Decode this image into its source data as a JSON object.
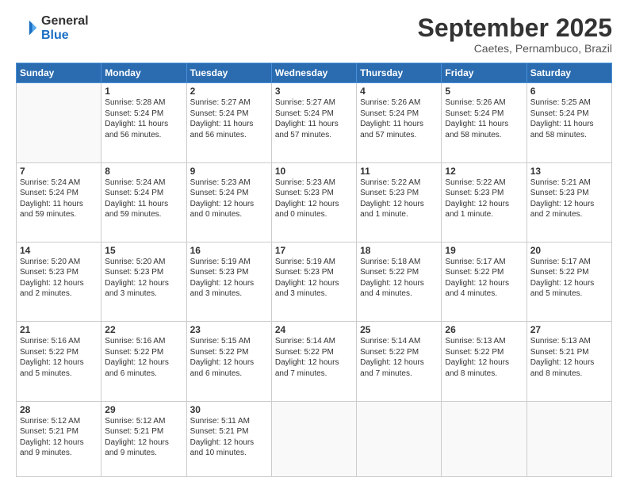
{
  "header": {
    "logo_line1": "General",
    "logo_line2": "Blue",
    "month": "September 2025",
    "location": "Caetes, Pernambuco, Brazil"
  },
  "weekdays": [
    "Sunday",
    "Monday",
    "Tuesday",
    "Wednesday",
    "Thursday",
    "Friday",
    "Saturday"
  ],
  "weeks": [
    [
      {
        "day": "",
        "info": ""
      },
      {
        "day": "1",
        "info": "Sunrise: 5:28 AM\nSunset: 5:24 PM\nDaylight: 11 hours\nand 56 minutes."
      },
      {
        "day": "2",
        "info": "Sunrise: 5:27 AM\nSunset: 5:24 PM\nDaylight: 11 hours\nand 56 minutes."
      },
      {
        "day": "3",
        "info": "Sunrise: 5:27 AM\nSunset: 5:24 PM\nDaylight: 11 hours\nand 57 minutes."
      },
      {
        "day": "4",
        "info": "Sunrise: 5:26 AM\nSunset: 5:24 PM\nDaylight: 11 hours\nand 57 minutes."
      },
      {
        "day": "5",
        "info": "Sunrise: 5:26 AM\nSunset: 5:24 PM\nDaylight: 11 hours\nand 58 minutes."
      },
      {
        "day": "6",
        "info": "Sunrise: 5:25 AM\nSunset: 5:24 PM\nDaylight: 11 hours\nand 58 minutes."
      }
    ],
    [
      {
        "day": "7",
        "info": "Sunrise: 5:24 AM\nSunset: 5:24 PM\nDaylight: 11 hours\nand 59 minutes."
      },
      {
        "day": "8",
        "info": "Sunrise: 5:24 AM\nSunset: 5:24 PM\nDaylight: 11 hours\nand 59 minutes."
      },
      {
        "day": "9",
        "info": "Sunrise: 5:23 AM\nSunset: 5:24 PM\nDaylight: 12 hours\nand 0 minutes."
      },
      {
        "day": "10",
        "info": "Sunrise: 5:23 AM\nSunset: 5:23 PM\nDaylight: 12 hours\nand 0 minutes."
      },
      {
        "day": "11",
        "info": "Sunrise: 5:22 AM\nSunset: 5:23 PM\nDaylight: 12 hours\nand 1 minute."
      },
      {
        "day": "12",
        "info": "Sunrise: 5:22 AM\nSunset: 5:23 PM\nDaylight: 12 hours\nand 1 minute."
      },
      {
        "day": "13",
        "info": "Sunrise: 5:21 AM\nSunset: 5:23 PM\nDaylight: 12 hours\nand 2 minutes."
      }
    ],
    [
      {
        "day": "14",
        "info": "Sunrise: 5:20 AM\nSunset: 5:23 PM\nDaylight: 12 hours\nand 2 minutes."
      },
      {
        "day": "15",
        "info": "Sunrise: 5:20 AM\nSunset: 5:23 PM\nDaylight: 12 hours\nand 3 minutes."
      },
      {
        "day": "16",
        "info": "Sunrise: 5:19 AM\nSunset: 5:23 PM\nDaylight: 12 hours\nand 3 minutes."
      },
      {
        "day": "17",
        "info": "Sunrise: 5:19 AM\nSunset: 5:23 PM\nDaylight: 12 hours\nand 3 minutes."
      },
      {
        "day": "18",
        "info": "Sunrise: 5:18 AM\nSunset: 5:22 PM\nDaylight: 12 hours\nand 4 minutes."
      },
      {
        "day": "19",
        "info": "Sunrise: 5:17 AM\nSunset: 5:22 PM\nDaylight: 12 hours\nand 4 minutes."
      },
      {
        "day": "20",
        "info": "Sunrise: 5:17 AM\nSunset: 5:22 PM\nDaylight: 12 hours\nand 5 minutes."
      }
    ],
    [
      {
        "day": "21",
        "info": "Sunrise: 5:16 AM\nSunset: 5:22 PM\nDaylight: 12 hours\nand 5 minutes."
      },
      {
        "day": "22",
        "info": "Sunrise: 5:16 AM\nSunset: 5:22 PM\nDaylight: 12 hours\nand 6 minutes."
      },
      {
        "day": "23",
        "info": "Sunrise: 5:15 AM\nSunset: 5:22 PM\nDaylight: 12 hours\nand 6 minutes."
      },
      {
        "day": "24",
        "info": "Sunrise: 5:14 AM\nSunset: 5:22 PM\nDaylight: 12 hours\nand 7 minutes."
      },
      {
        "day": "25",
        "info": "Sunrise: 5:14 AM\nSunset: 5:22 PM\nDaylight: 12 hours\nand 7 minutes."
      },
      {
        "day": "26",
        "info": "Sunrise: 5:13 AM\nSunset: 5:22 PM\nDaylight: 12 hours\nand 8 minutes."
      },
      {
        "day": "27",
        "info": "Sunrise: 5:13 AM\nSunset: 5:21 PM\nDaylight: 12 hours\nand 8 minutes."
      }
    ],
    [
      {
        "day": "28",
        "info": "Sunrise: 5:12 AM\nSunset: 5:21 PM\nDaylight: 12 hours\nand 9 minutes."
      },
      {
        "day": "29",
        "info": "Sunrise: 5:12 AM\nSunset: 5:21 PM\nDaylight: 12 hours\nand 9 minutes."
      },
      {
        "day": "30",
        "info": "Sunrise: 5:11 AM\nSunset: 5:21 PM\nDaylight: 12 hours\nand 10 minutes."
      },
      {
        "day": "",
        "info": ""
      },
      {
        "day": "",
        "info": ""
      },
      {
        "day": "",
        "info": ""
      },
      {
        "day": "",
        "info": ""
      }
    ]
  ]
}
